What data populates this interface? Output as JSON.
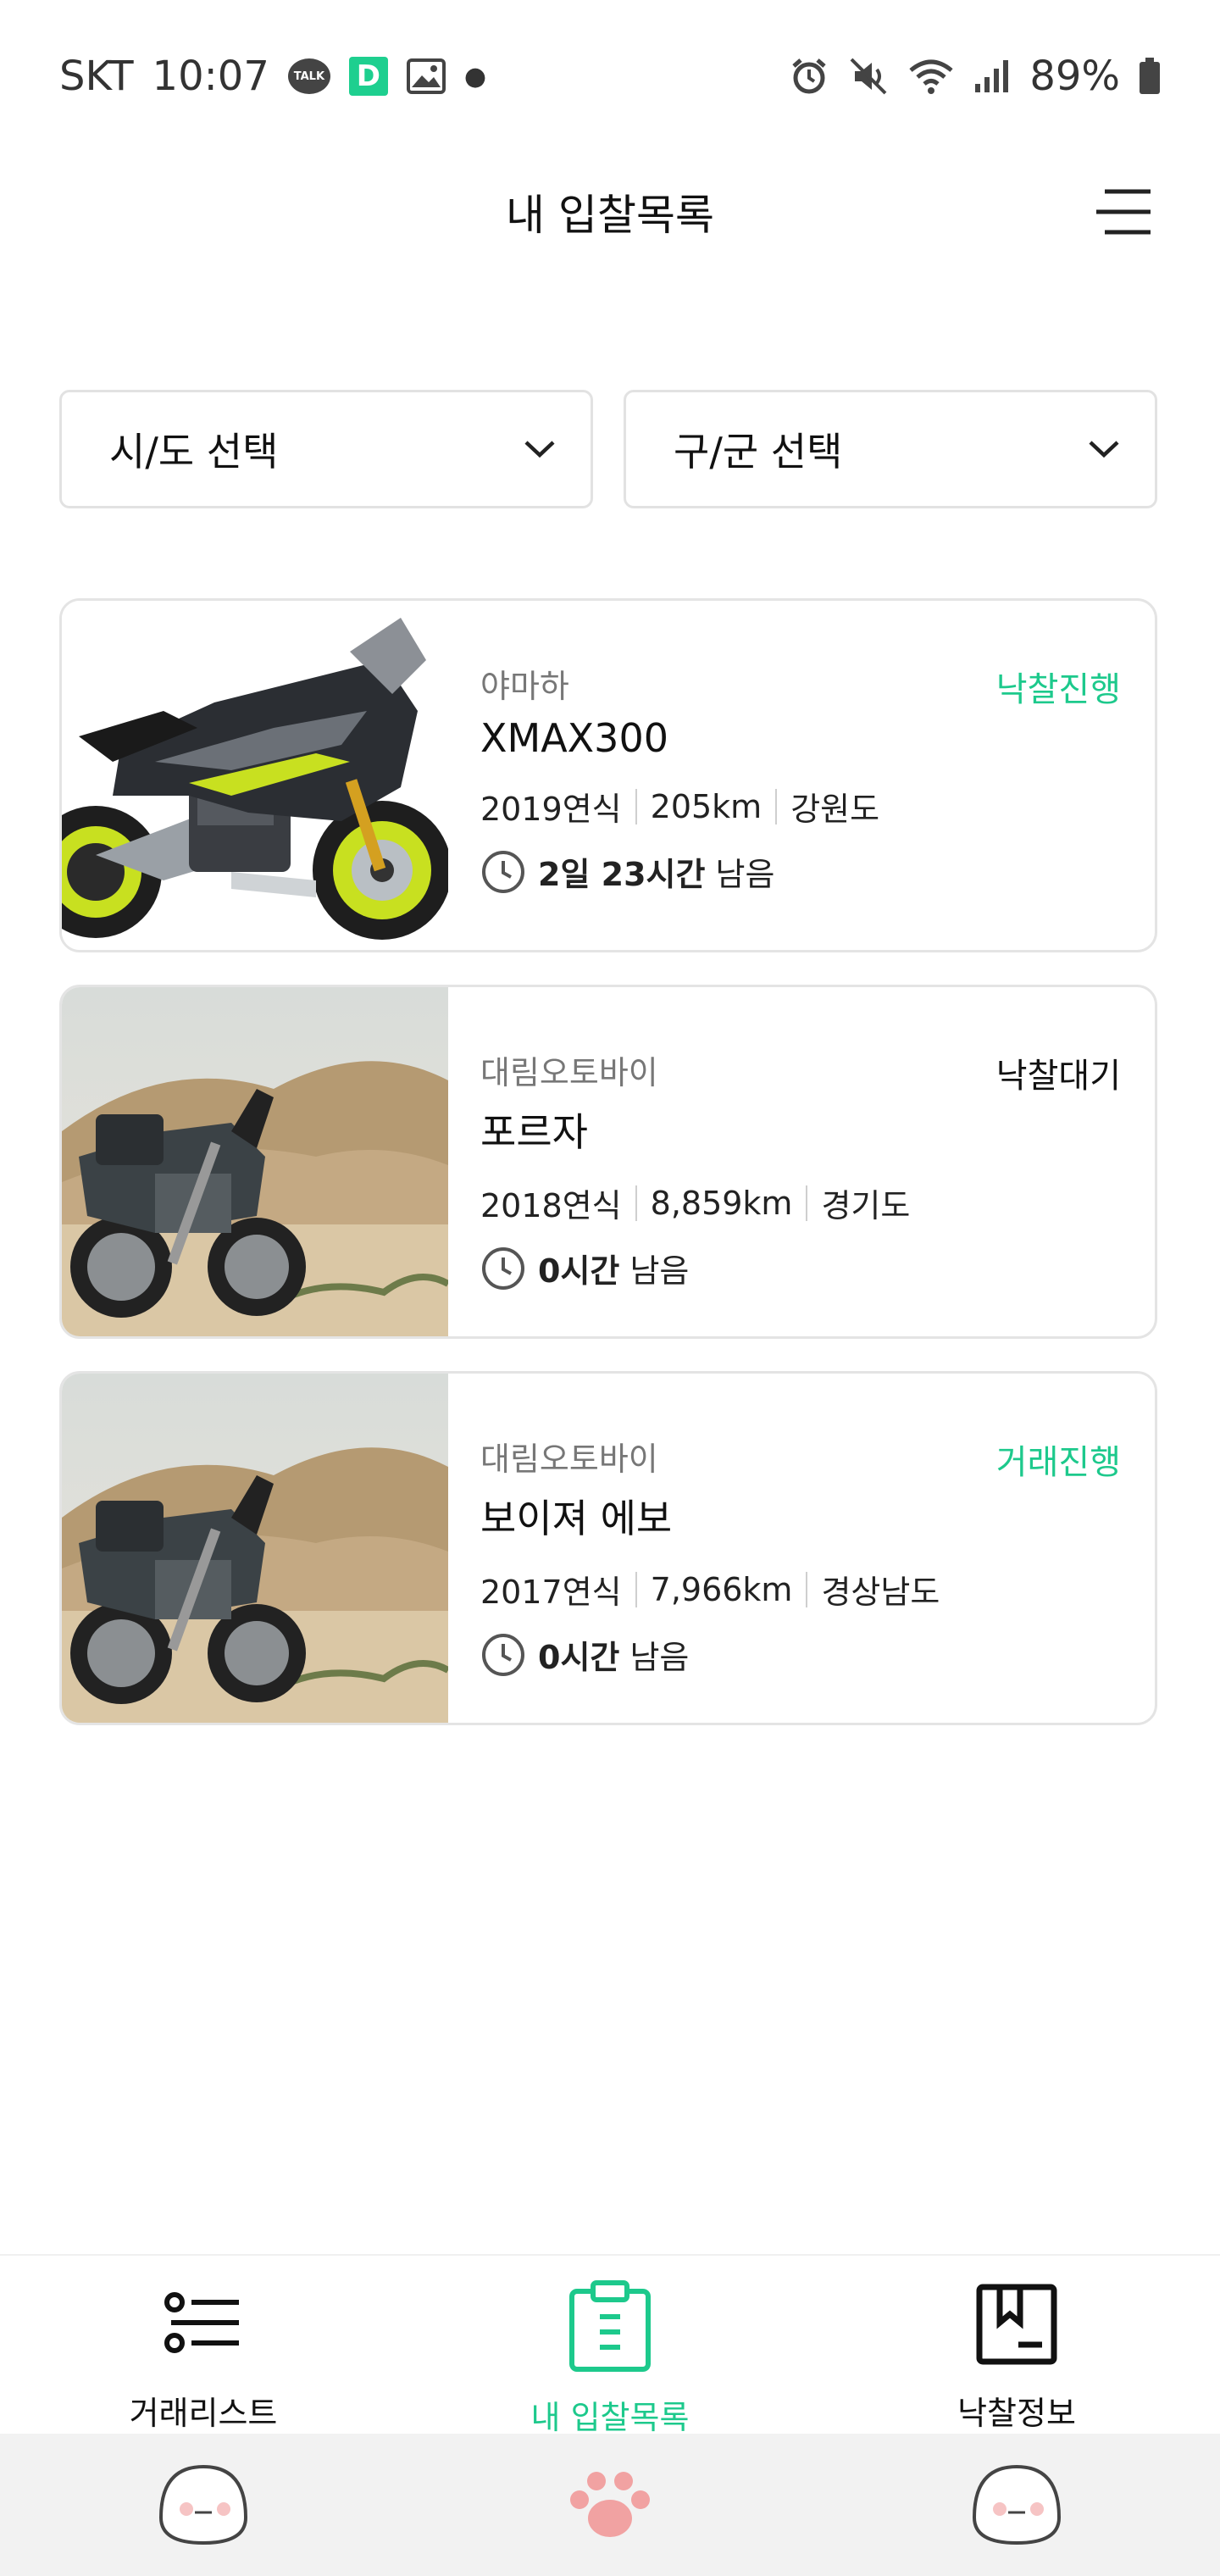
{
  "status_bar": {
    "carrier": "SKT",
    "time": "10:07",
    "talk_badge": "TALK",
    "d_badge": "D",
    "battery": "89%"
  },
  "header": {
    "title": "내 입찰목록"
  },
  "filters": {
    "city": "시/도 선택",
    "district": "구/군 선택"
  },
  "bids": [
    {
      "brand": "야마하",
      "model": "XMAX300",
      "status": "낙찰진행",
      "status_color": "#1dc98c",
      "year": "2019연식",
      "mileage": "205km",
      "region": "강원도",
      "time_bold": "2일 23시간",
      "time_suffix": " 남음"
    },
    {
      "brand": "대림오토바이",
      "model": "포르자",
      "status": "낙찰대기",
      "status_color": "#111111",
      "year": "2018연식",
      "mileage": "8,859km",
      "region": "경기도",
      "time_bold": "0시간",
      "time_suffix": " 남음"
    },
    {
      "brand": "대림오토바이",
      "model": "보이져 에보",
      "status": "거래진행",
      "status_color": "#1dc98c",
      "year": "2017연식",
      "mileage": "7,966km",
      "region": "경상남도",
      "time_bold": "0시간",
      "time_suffix": " 남음"
    }
  ],
  "bottom_nav": {
    "items": [
      {
        "label": "거래리스트",
        "icon": "list-icon",
        "active": false
      },
      {
        "label": "내 입찰목록",
        "icon": "clipboard-icon",
        "active": true
      },
      {
        "label": "낙찰정보",
        "icon": "bookmark-icon",
        "active": false
      }
    ],
    "active_color": "#1dc98c"
  },
  "colors": {
    "accent": "#1dc98c"
  }
}
